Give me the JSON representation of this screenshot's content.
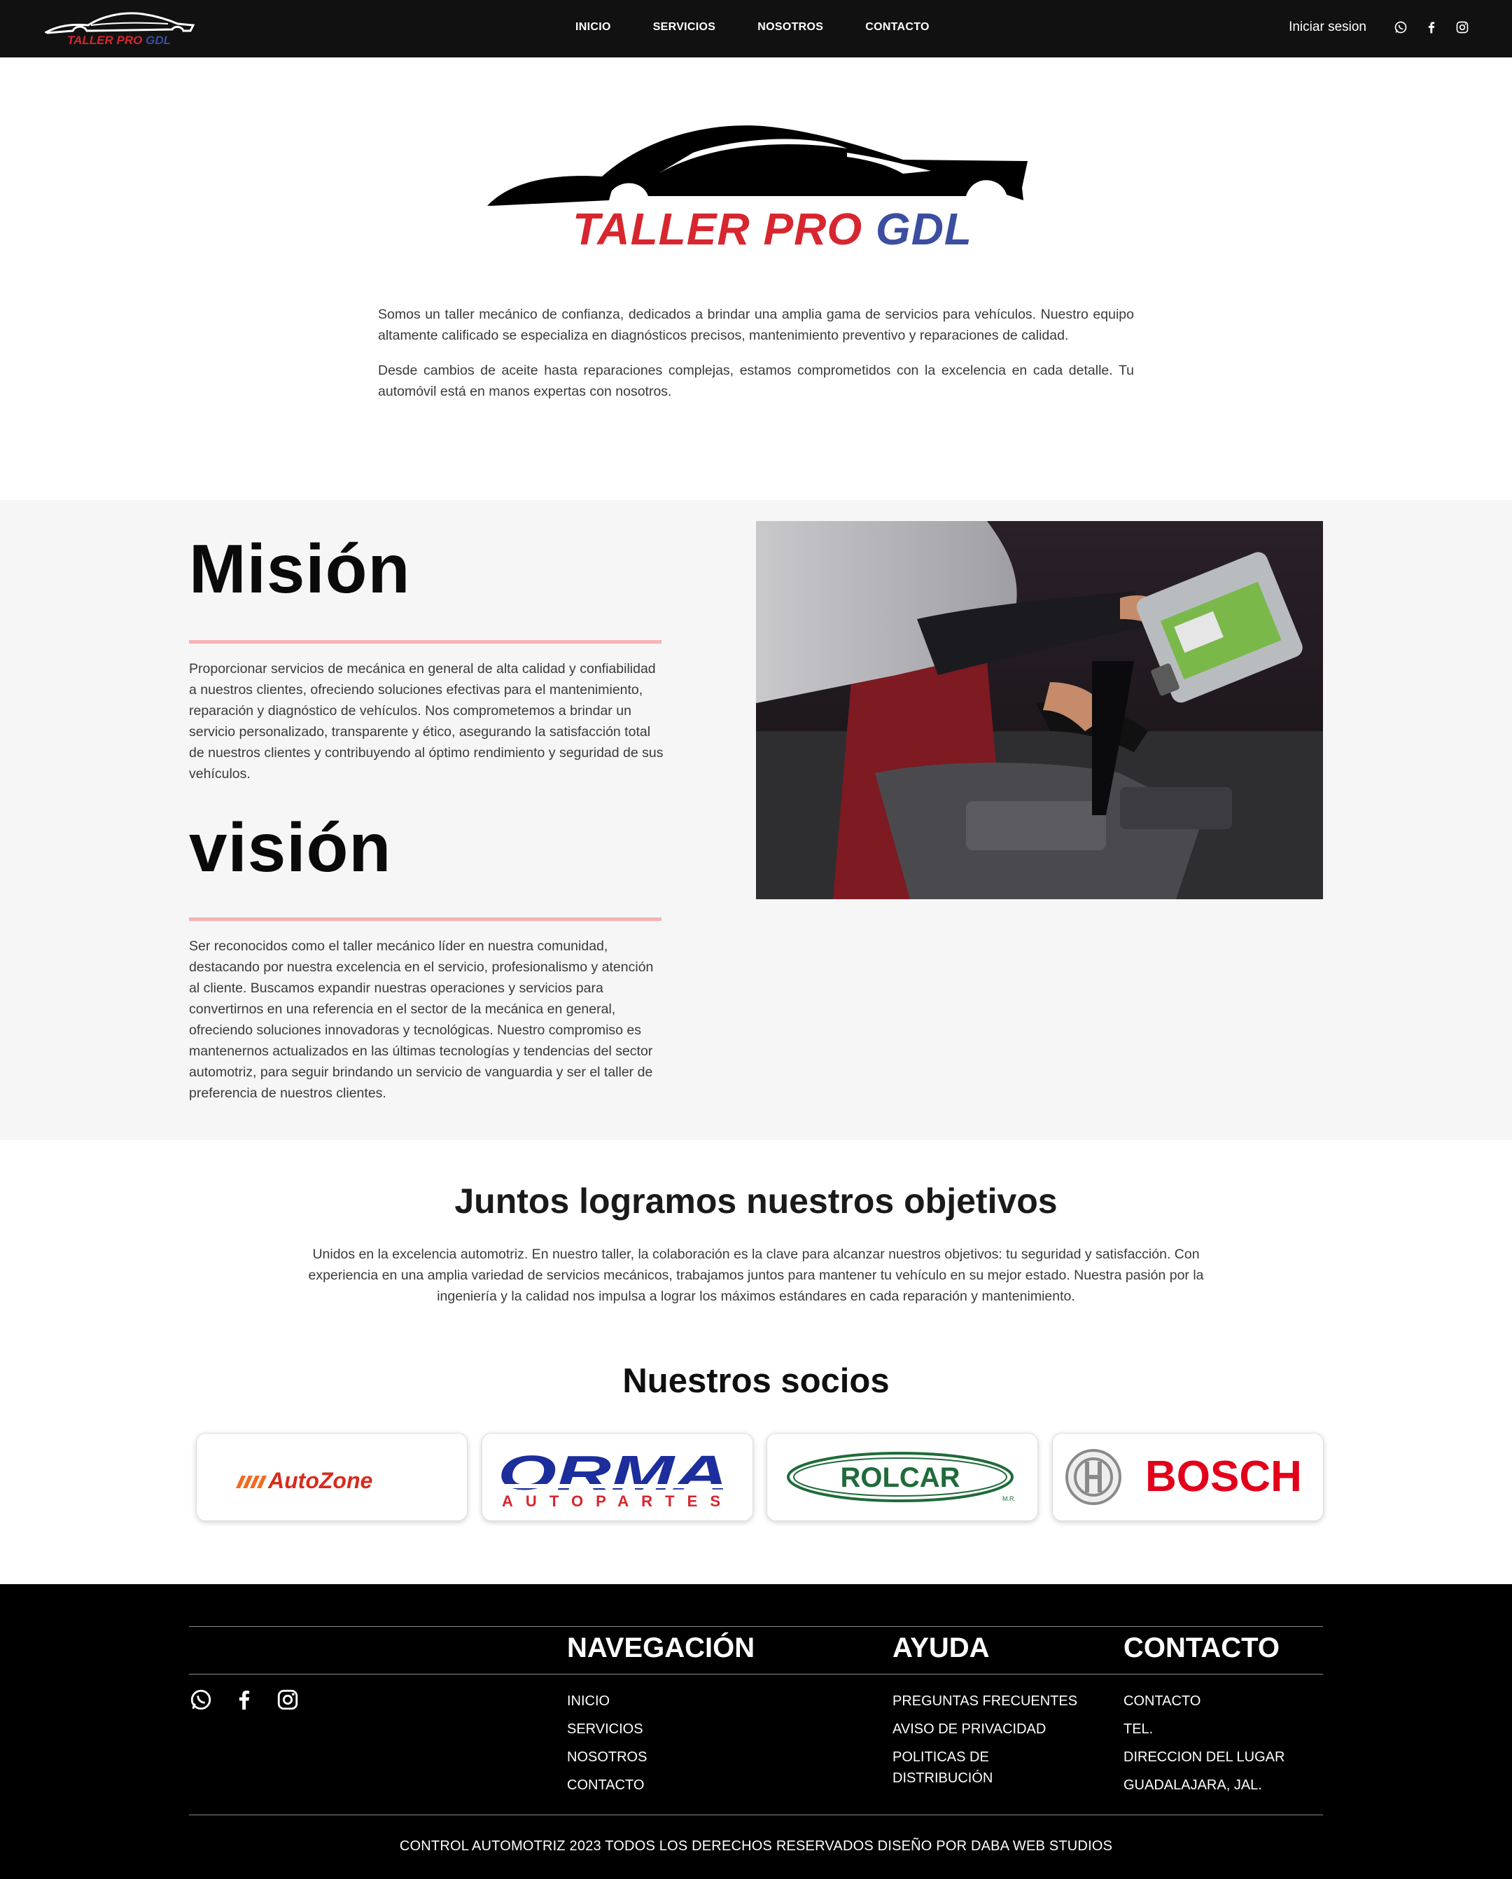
{
  "navbar": {
    "logo": {
      "word1": "TALLER PRO",
      "word2": "GDL"
    },
    "links": [
      "INICIO",
      "SERVICIOS",
      "NOSOTROS",
      "CONTACTO"
    ],
    "login_label": "Iniciar sesion",
    "social_icons": [
      "whatsapp-icon",
      "facebook-icon",
      "instagram-icon"
    ]
  },
  "hero": {
    "logo": {
      "word1": "TALLER PRO",
      "word2": "GDL"
    },
    "paragraphs": [
      "Somos un taller mecánico de confianza, dedicados a brindar una amplia gama de servicios para vehículos. Nuestro equipo altamente calificado se especializa en diagnósticos precisos, mantenimiento preventivo y reparaciones de calidad.",
      "Desde cambios de aceite hasta reparaciones complejas, estamos comprometidos con la excelencia en cada detalle. Tu automóvil está en manos expertas con nosotros."
    ]
  },
  "mission": {
    "title": "Misión",
    "text": "Proporcionar servicios de mecánica en general de alta calidad y confiabilidad a nuestros clientes, ofreciendo soluciones efectivas para el mantenimiento, reparación y diagnóstico de vehículos. Nos comprometemos a brindar un servicio personalizado, transparente y ético, asegurando la satisfacción total de nuestros clientes y contribuyendo al óptimo rendimiento y seguridad de sus vehículos."
  },
  "vision": {
    "title": "visión",
    "text": "Ser reconocidos como el taller mecánico líder en nuestra comunidad, destacando por nuestra excelencia en el servicio, profesionalismo y atención al cliente. Buscamos expandir nuestras operaciones y servicios para convertirnos en una referencia en el sector de la mecánica en general, ofreciendo soluciones innovadoras y tecnológicas. Nuestro compromiso es mantenernos actualizados en las últimas tecnologías y tendencias del sector automotriz, para seguir brindando un servicio de vanguardia y ser el taller de preferencia de nuestros clientes."
  },
  "objectives": {
    "title": "Juntos logramos nuestros objetivos",
    "text": "Unidos en la excelencia automotriz. En nuestro taller, la colaboración es la clave para alcanzar nuestros objetivos: tu seguridad y satisfacción. Con experiencia en una amplia variedad de servicios mecánicos, trabajamos juntos para mantener tu vehículo en su mejor estado. Nuestra pasión por la ingeniería y la calidad nos impulsa a lograr los máximos estándares en cada reparación y mantenimiento."
  },
  "partners": {
    "title": "Nuestros socios",
    "logos": {
      "autozone": "AutoZone",
      "orma": {
        "main": "ORMA",
        "sub": "AUTOPARTES"
      },
      "rolcar": {
        "main": "ROLCAR",
        "mark": "M.R."
      },
      "bosch": "BOSCH"
    }
  },
  "footer": {
    "navigation": {
      "title": "NAVEGACIÓN",
      "items": [
        "INICIO",
        "SERVICIOS",
        "NOSOTROS",
        "CONTACTO"
      ]
    },
    "help": {
      "title": "AYUDA",
      "items": [
        "PREGUNTAS FRECUENTES",
        "AVISO DE PRIVACIDAD",
        "POLITICAS DE DISTRIBUCIÓN"
      ]
    },
    "contact": {
      "title": "CONTACTO",
      "items": [
        "CONTACTO",
        "TEL.",
        "DIRECCION DEL LUGAR",
        "GUADALAJARA, JAL."
      ]
    },
    "social_icons": [
      "whatsapp-icon",
      "facebook-icon",
      "instagram-icon"
    ],
    "copyright": "CONTROL AUTOMOTRIZ 2023 TODOS LOS DERECHOS RESERVADOS DISEÑO POR DABA WEB STUDIOS"
  },
  "colors": {
    "logo_red": "#d7262f",
    "logo_blue": "#3b4ea0",
    "accent_rule": "#f5b3b3",
    "nav_bg": "#111111",
    "footer_bg": "#000000"
  }
}
